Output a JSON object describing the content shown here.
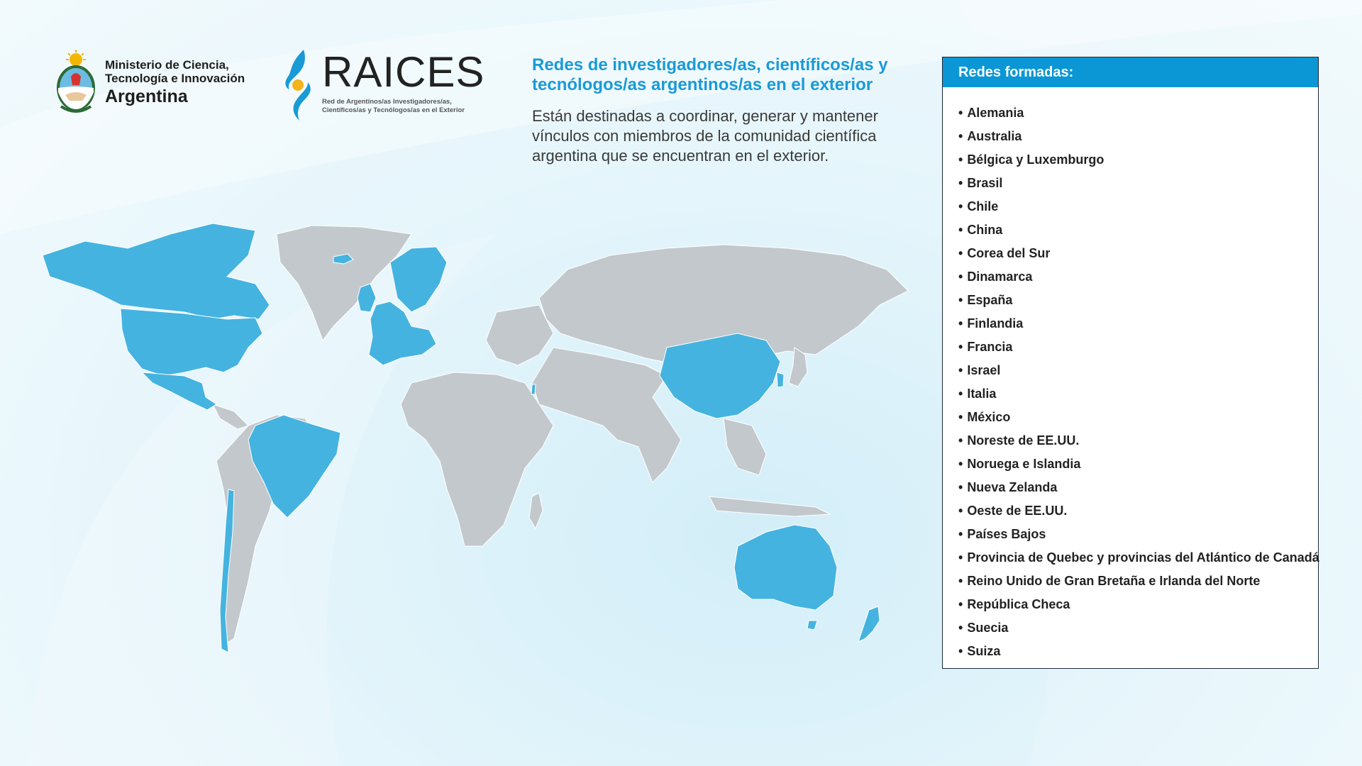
{
  "ministry": {
    "line1": "Ministerio de Ciencia,",
    "line2": "Tecnología e Innovación",
    "line3": "Argentina"
  },
  "raices": {
    "name": "RAICES",
    "subtitle_line1": "Red de Argentinos/as Investigadores/as,",
    "subtitle_line2": "Científicos/as y Tecnólogos/as en el Exterior"
  },
  "headline": {
    "title": "Redes de investigadores/as, científicos/as y tecnólogos/as argentinos/as en el exterior",
    "description": "Están destinadas a coordinar, generar y mantener vínculos con miembros de la comunidad científica argentina que se encuentran en el exterior."
  },
  "panel": {
    "title": "Redes formadas:",
    "bullet": "•",
    "items": [
      "Alemania",
      "Australia",
      "Bélgica y Luxemburgo",
      "Brasil",
      "Chile",
      "China",
      "Corea del Sur",
      "Dinamarca",
      "España",
      "Finlandia",
      "Francia",
      "Israel",
      "Italia",
      "México",
      "Noreste de EE.UU.",
      "Noruega e Islandia",
      "Nueva Zelanda",
      "Oeste de EE.UU.",
      "Países Bajos",
      "Provincia de Quebec y provincias del Atlántico de Canadá",
      "Reino Unido de Gran Bretaña e Irlanda del Norte",
      "República Checa",
      "Suecia",
      "Suiza"
    ]
  },
  "colors": {
    "highlight": "#45b3e0",
    "land": "#c3c8cc",
    "accent": "#0b97d5",
    "title": "#1a9ad6"
  }
}
